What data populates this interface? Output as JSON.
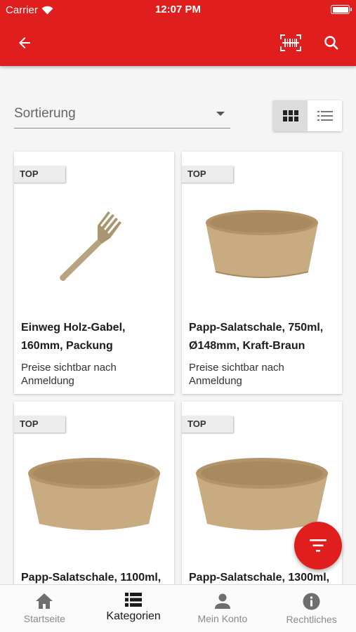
{
  "status_bar": {
    "carrier": "Carrier",
    "time": "12:07 PM"
  },
  "app_bar": {
    "back_icon": "arrow-left-icon",
    "scan_icon": "barcode-scan-icon",
    "search_icon": "search-icon"
  },
  "sort": {
    "label": "Sortierung"
  },
  "view_toggle": {
    "active": "grid"
  },
  "products": [
    {
      "badge": "TOP",
      "name": "Einweg Holz-Gabel, 160mm, Packung",
      "price": "Preise sichtbar nach Anmeldung",
      "image": "wooden-fork"
    },
    {
      "badge": "TOP",
      "name": "Papp-Salatschale, 750ml, Ø148mm, Kraft-Braun",
      "price": "Preise sichtbar nach Anmeldung",
      "image": "kraft-bowl"
    },
    {
      "badge": "TOP",
      "name": "Papp-Salatschale, 1100ml,",
      "price": "",
      "image": "kraft-bowl"
    },
    {
      "badge": "TOP",
      "name": "Papp-Salatschale, 1300ml,",
      "price": "",
      "image": "kraft-bowl"
    }
  ],
  "bottom_nav": [
    {
      "label": "Startseite",
      "icon": "home-icon"
    },
    {
      "label": "Kategorien",
      "icon": "list-icon",
      "active": true
    },
    {
      "label": "Mein Konto",
      "icon": "person-icon"
    },
    {
      "label": "Rechtliches",
      "icon": "info-icon"
    }
  ],
  "colors": {
    "brand": "#e01e1e",
    "card": "#ffffff",
    "background": "#f5f5f5"
  }
}
